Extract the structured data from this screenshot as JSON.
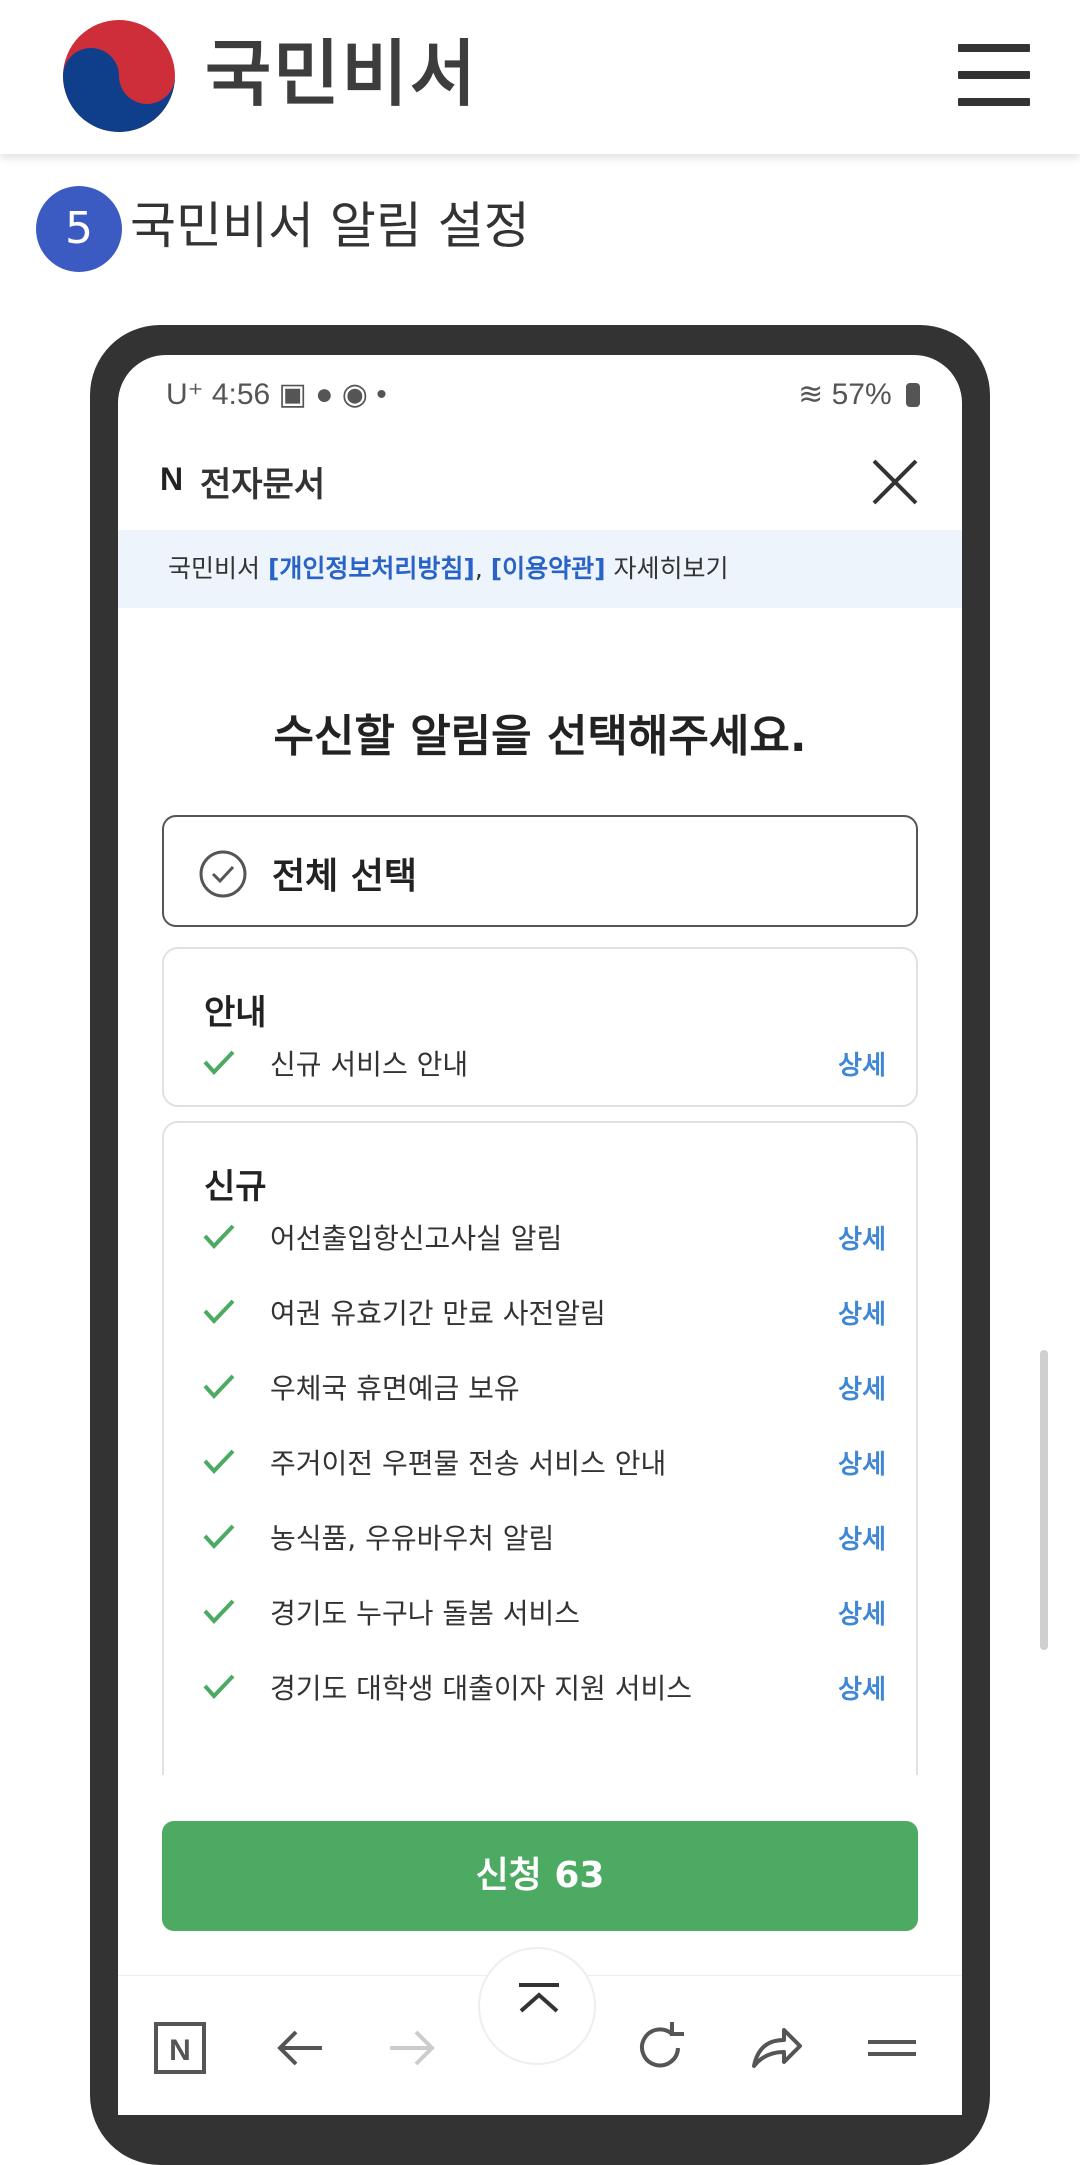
{
  "site": {
    "title": "국민비서"
  },
  "step": {
    "number": "5",
    "title": "국민비서 알림 설정"
  },
  "phone": {
    "status": {
      "left": "U⁺ 4:56 ▣ ● ◉ •",
      "right": "57%"
    },
    "app": {
      "title": "전자문서",
      "logo": "N"
    },
    "notice": {
      "prefix": "국민비서 ",
      "link1": "[개인정보처리방침]",
      "sep": ", ",
      "link2": "[이용약관]",
      "suffix": " 자세히보기"
    },
    "question": "수신할 알림을 선택해주세요.",
    "select_all": "전체 선택",
    "sections": [
      {
        "title": "안내",
        "items": [
          {
            "label": "신규 서비스 안내",
            "detail": "상세"
          }
        ]
      },
      {
        "title": "신규",
        "items": [
          {
            "label": "어선출입항신고사실 알림",
            "detail": "상세"
          },
          {
            "label": "여권 유효기간 만료 사전알림",
            "detail": "상세"
          },
          {
            "label": "우체국 휴면예금 보유",
            "detail": "상세"
          },
          {
            "label": "주거이전 우편물 전송 서비스 안내",
            "detail": "상세"
          },
          {
            "label": "농식품, 우유바우처 알림",
            "detail": "상세"
          },
          {
            "label": "경기도 누구나 돌봄 서비스",
            "detail": "상세"
          },
          {
            "label": "경기도 대학생 대출이자 지원 서비스",
            "detail": "상세"
          }
        ]
      }
    ],
    "apply_button": "신청 63",
    "colors": {
      "accent_green": "#4caa62",
      "link_blue": "#2a63c8",
      "detail_blue": "#3f87d4",
      "step_badge": "#3b5bc3"
    }
  }
}
